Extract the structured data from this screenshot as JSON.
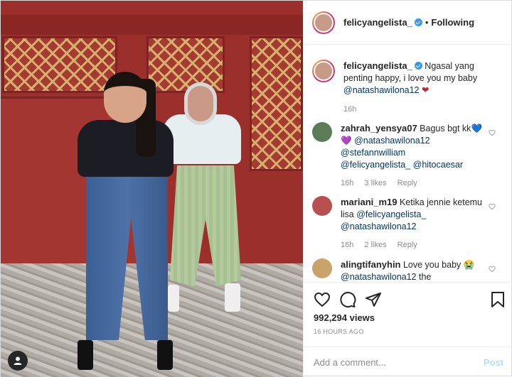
{
  "post": {
    "author": "felicyangelista_",
    "follow_sep": "•",
    "follow_state": "Following",
    "caption_author": "felicyangelista_",
    "caption_text": " Ngasal yang penting happy, i love you my baby ",
    "caption_mention": "@natashawilona12",
    "caption_emoji": "❤",
    "caption_time": "16h"
  },
  "comments": [
    {
      "user": "zahrah_yensya07",
      "text": " Bagus bgt kk",
      "emoji1": "💙",
      "emoji2": "💜",
      "mentions": [
        "@natashawilona12",
        "@stefannwilliam",
        "@felicyangelista_",
        "@hitocaesar"
      ],
      "time": "16h",
      "likes": "3 likes",
      "reply": "Reply"
    },
    {
      "user": "mariani_m19",
      "text": " Ketika jennie ketemu lisa ",
      "mentions": [
        "@felicyangelista_",
        "@natashawilona12"
      ],
      "time": "16h",
      "likes": "2 likes",
      "reply": "Reply"
    },
    {
      "user": "alingtifanyhin",
      "text": " Love you baby ",
      "emoji": "😭",
      "mentions": [
        "@natashawilona12"
      ],
      "tail": " the"
    }
  ],
  "stats": {
    "views": "992,294 views",
    "ago": "16 HOURS AGO"
  },
  "add_comment": {
    "placeholder": "Add a comment...",
    "post_label": "Post"
  },
  "colors": {
    "link": "#00376b",
    "verified": "#3897f0",
    "post_button": "#b2dffc",
    "muted": "#8e8e8e"
  }
}
